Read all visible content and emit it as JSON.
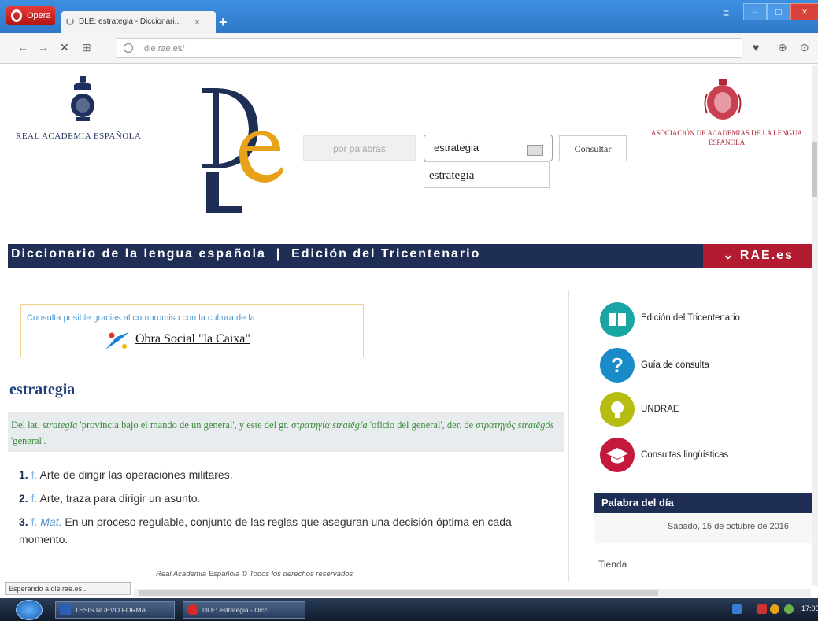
{
  "browser": {
    "opera_label": "Opera",
    "tab_title": "DLE: estrategia - Diccionari...",
    "tab_close": "×",
    "new_tab": "+",
    "filter_icon": "≡",
    "minimize": "–",
    "maximize": "□",
    "close": "×",
    "url": "dle.rae.es/",
    "nav": {
      "back": "←",
      "forward": "→",
      "stop": "✕",
      "speed_dial": "⊞"
    },
    "right_icons": {
      "heart": "♥",
      "download": "⊕",
      "extra": "⊙"
    }
  },
  "header": {
    "rae_name": "REAL ACADEMIA ESPAÑOLA",
    "search_mode": "por palabras",
    "search_value": "estrategia",
    "suggestion": "estrategia",
    "consult_button": "Consultar",
    "asale_name": "ASOCIACIÓN DE ACADEMIAS DE LA LENGUA ESPAÑOLA"
  },
  "band": {
    "title": "Diccionario de la lengua española  |  Edición del Tricentenario",
    "rae_link": "⌄ RAE.es"
  },
  "sponsor": {
    "text": "Consulta posible gracias al compromiso con la cultura de la",
    "name": "Obra Social \"la Caixa\""
  },
  "entry": {
    "word": "estrategia",
    "etymology": {
      "prefix": "Del lat.",
      "latin": "strategĭa",
      "latin_gloss": "'provincia bajo el mando de un general', y este del gr.",
      "greek": "στρατηγία",
      "greek_tr": "stratēgía",
      "greek_gloss": "'oficio del general', der. de",
      "greek2": "στρατηγός",
      "greek2_tr": "stratēgós",
      "greek2_gloss": "'general'."
    },
    "definitions": [
      {
        "num": "1.",
        "abbr": "f.",
        "mark": "",
        "text": "Arte de dirigir las operaciones militares."
      },
      {
        "num": "2.",
        "abbr": "f.",
        "mark": "",
        "text": "Arte, traza para dirigir un asunto."
      },
      {
        "num": "3.",
        "abbr": "f.",
        "mark": "Mat.",
        "text": "En un proceso regulable, conjunto de las reglas que aseguran una decisión óptima en cada momento."
      }
    ],
    "copyright": "Real Academia Española © Todos los derechos reservados"
  },
  "sidebar": {
    "items": [
      {
        "label": "Edición del Tricentenario",
        "color": "#1aa5a5"
      },
      {
        "label": "Guía de consulta",
        "color": "#1a8bc9"
      },
      {
        "label": "UNDRAE",
        "color": "#b5bd12"
      },
      {
        "label": "Consultas lingüísticas",
        "color": "#c4183c"
      }
    ],
    "word_of_day_title": "Palabra del día",
    "word_of_day_date": "Sábado, 15 de octubre de 2016",
    "shop": "Tienda"
  },
  "status_text": "Esperando a dle.rae.es...",
  "taskbar": {
    "btn1": "TESIS NUEVO FORMA...",
    "btn2": "DLE: estrategia - Dicc...",
    "clock": "17:06"
  },
  "colors": {
    "navy": "#1f2e55",
    "crimson": "#b31b31",
    "dle_gold": "#e8a21a"
  }
}
